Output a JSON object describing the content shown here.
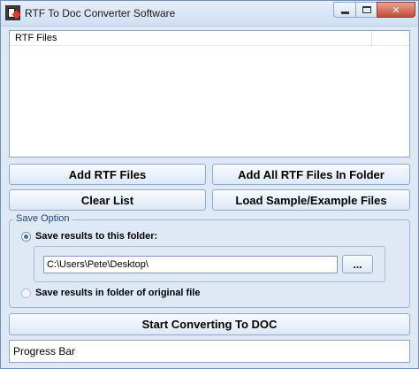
{
  "window": {
    "title": "RTF To Doc Converter Software",
    "close_glyph": "✕"
  },
  "file_list": {
    "column_header": "RTF Files",
    "items": []
  },
  "buttons": {
    "add_files": "Add RTF Files",
    "add_all_in_folder": "Add All RTF Files In Folder",
    "clear_list": "Clear List",
    "load_sample": "Load Sample/Example Files",
    "start": "Start Converting To DOC",
    "browse": "..."
  },
  "save_option": {
    "title": "Save Option",
    "option_folder_label": "Save results to this folder:",
    "option_original_label": "Save results in folder of original file",
    "selected": "folder",
    "folder_path": "C:\\Users\\Pete\\Desktop\\"
  },
  "progress": {
    "label": "Progress Bar"
  },
  "colors": {
    "window_bg": "#dfe9f6",
    "border": "#8fa6c2",
    "close_button": "#c44a36"
  }
}
